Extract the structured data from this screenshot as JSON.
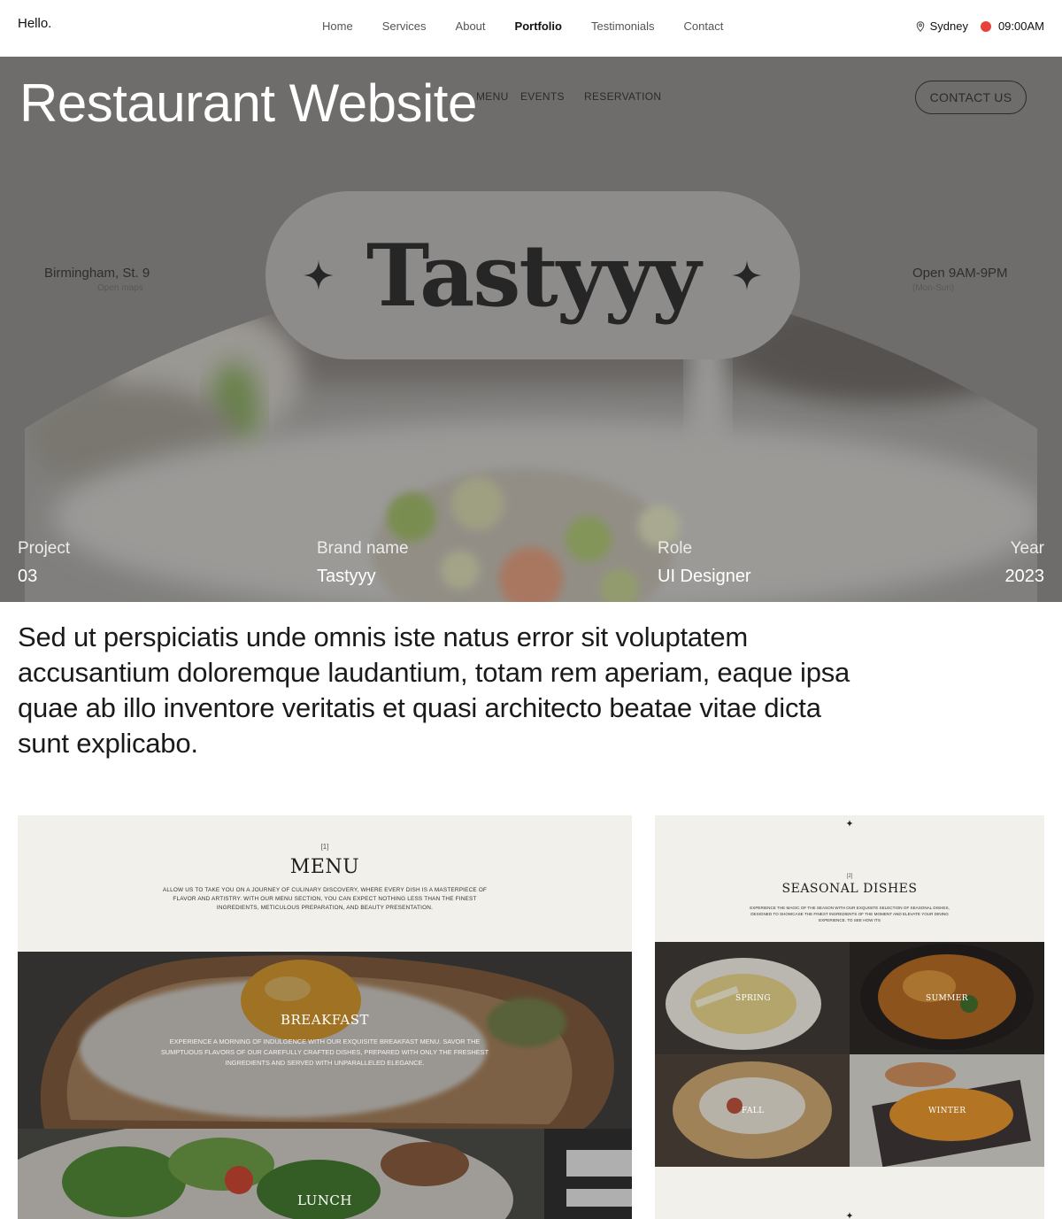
{
  "header": {
    "brand": "Hello.",
    "nav": [
      {
        "label": "Home",
        "active": false
      },
      {
        "label": "Services",
        "active": false
      },
      {
        "label": "About",
        "active": false
      },
      {
        "label": "Portfolio",
        "active": true
      },
      {
        "label": "Testimonials",
        "active": false
      },
      {
        "label": "Contact",
        "active": false
      }
    ],
    "location": "Sydney",
    "time": "09:00AM",
    "location_icon": "map-pin-icon",
    "status_color": "#e8413a"
  },
  "hero": {
    "title": "Restaurant Website",
    "mock_nav": [
      "MENU",
      "EVENTS",
      "RESERVATION"
    ],
    "mock_contact_label": "CONTACT US",
    "logo": "Tastyyy",
    "address": "Birmingham, St. 9",
    "address_sub": "Open maps",
    "hours": "Open 9AM-9PM",
    "hours_sub": "(Mon-Sun)",
    "meta": [
      {
        "label": "Project",
        "value": "03"
      },
      {
        "label": "Brand name",
        "value": "Tastyyy"
      },
      {
        "label": "Role",
        "value": "UI Designer"
      },
      {
        "label": "Year",
        "value": "2023"
      }
    ]
  },
  "intro": "Sed ut perspiciatis unde omnis iste natus error sit voluptatem accusantium doloremque laudantium, totam rem aperiam, eaque ipsa quae ab illo inventore veritatis et quasi architecto beatae vitae dicta sunt explicabo.",
  "menu_preview": {
    "number": "[1]",
    "heading": "MENU",
    "description": "ALLOW US TO TAKE YOU ON A JOURNEY OF CULINARY DISCOVERY, WHERE EVERY DISH IS A MASTERPIECE OF FLAVOR AND ARTISTRY. WITH OUR MENU SECTION, YOU CAN EXPECT NOTHING LESS THAN THE FINEST INGREDIENTS, METICULOUS PREPARATION, AND BEAUTY PRESENTATION.",
    "breakfast_title": "BREAKFAST",
    "breakfast_desc": "EXPERIENCE A MORNING OF INDULGENCE WITH OUR EXQUISITE BREAKFAST MENU. SAVOR THE SUMPTUOUS FLAVORS OF OUR CAREFULLY CRAFTED DISHES, PREPARED WITH ONLY THE FRESHEST INGREDIENTS AND SERVED WITH UNPARALLELED ELEGANCE.",
    "lunch_title": "LUNCH"
  },
  "seasonal_preview": {
    "number": "[2]",
    "heading": "SEASONAL DISHES",
    "description": "EXPERIENCE THE MAGIC OF THE SEASON WITH OUR EXQUISITE SELECTION OF SEASONAL DISHES, DESIGNED TO SHOWCASE THE FINEST INGREDIENTS OF THE MOMENT AND ELEVATE YOUR DINING EXPERIENCE. TO SEE HOW ITS",
    "tiles": [
      "SPRING",
      "SUMMER",
      "FALL",
      "WINTER"
    ]
  },
  "colors": {
    "page_bg": "#ffffff",
    "card_bg": "#f2f0ea",
    "status_dot": "#e8413a"
  }
}
